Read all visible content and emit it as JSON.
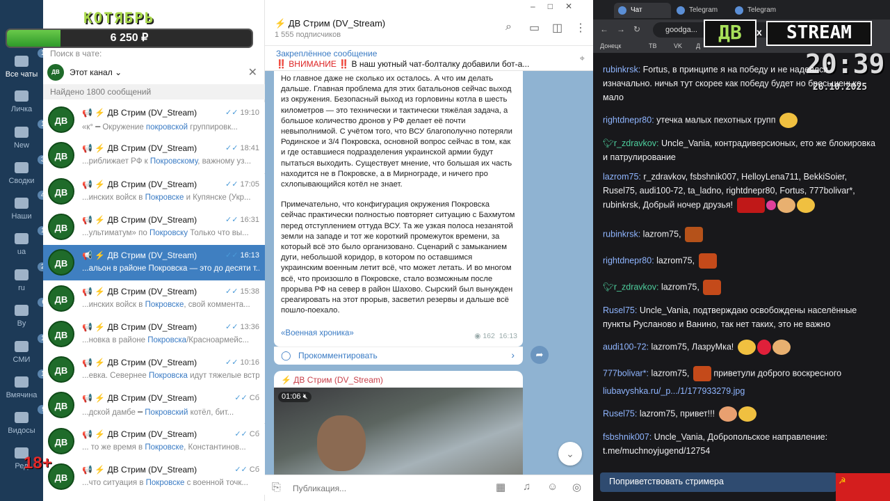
{
  "overlay": {
    "brand": "КОТЯБРЬ",
    "amount": "6 250 ₽",
    "progress_fraction": 0.22,
    "age": "18+"
  },
  "folders": [
    {
      "label": "Все чаты",
      "badge": "174"
    },
    {
      "label": "Личка",
      "badge": ""
    },
    {
      "label": "New",
      "badge": "155"
    },
    {
      "label": "Сводки",
      "badge": "33"
    },
    {
      "label": "Наши",
      "badge": "45"
    },
    {
      "label": "ua",
      "badge": "12"
    },
    {
      "label": "ru",
      "badge": "27"
    },
    {
      "label": "By",
      "badge": "6"
    },
    {
      "label": "СМИ",
      "badge": "12"
    },
    {
      "label": "Вмячина",
      "badge": "18"
    },
    {
      "label": "Видосы",
      "badge": "9"
    },
    {
      "label": "Ред",
      "badge": ""
    }
  ],
  "search": {
    "label": "Поиск в чате:",
    "scope": "Этот канал",
    "found": "Найдено 1800 сообщений",
    "avatar": "ДВ"
  },
  "results": [
    {
      "title": "📢 ⚡ ДВ Стрим (DV_Stream)",
      "time": "19:10",
      "pre": "«к° ━ Окружение ",
      "hl": "покровской",
      "post": " группировк..."
    },
    {
      "title": "📢 ⚡ ДВ Стрим (DV_Stream)",
      "time": "18:41",
      "pre": "...риближает РФ к ",
      "hl": "Покровскому",
      "post": ", важному уз..."
    },
    {
      "title": "📢 ⚡ ДВ Стрим (DV_Stream)",
      "time": "17:05",
      "pre": "...инских войск в ",
      "hl": "Покровске",
      "post": " и Купянске (Укр..."
    },
    {
      "title": "📢 ⚡ ДВ Стрим (DV_Stream)",
      "time": "16:31",
      "pre": "...ультиматум» по ",
      "hl": "Покровску",
      "post": " Только что вы..."
    },
    {
      "title": "📢 ⚡ ДВ Стрим (DV_Stream)",
      "time": "16:13",
      "pre": "...альон в районе Покровска — это до десяти т...",
      "hl": "",
      "post": ""
    },
    {
      "title": "📢 ⚡ ДВ Стрим (DV_Stream)",
      "time": "15:38",
      "pre": "...инских войск в ",
      "hl": "Покровске",
      "post": ", свой коммента..."
    },
    {
      "title": "📢 ⚡ ДВ Стрим (DV_Stream)",
      "time": "13:36",
      "pre": "...новка в районе ",
      "hl": "Покровска",
      "post": "/Красноармейс..."
    },
    {
      "title": "📢 ⚡ ДВ Стрим (DV_Stream)",
      "time": "10:16",
      "pre": "...евка. Севернее ",
      "hl": "Покровска",
      "post": " идут тяжелые встр..."
    },
    {
      "title": "📢 ⚡ ДВ Стрим (DV_Stream)",
      "time": "Сб",
      "pre": "...дской дамбе ━ ",
      "hl": "Покровский",
      "post": " котёл, бит..."
    },
    {
      "title": "📢 ⚡ ДВ Стрим (DV_Stream)",
      "time": "Сб",
      "pre": "... то же время в ",
      "hl": "Покровске",
      "post": ", Константинов..."
    },
    {
      "title": "📢 ⚡ ДВ Стрим (DV_Stream)",
      "time": "Сб",
      "pre": "...что ситуация в ",
      "hl": "Покровске",
      "post": " с военной точк..."
    }
  ],
  "header": {
    "title": "⚡ ДВ Стрим (DV_Stream)",
    "subs": "1 555 подписчиков"
  },
  "pinned": {
    "title": "Закреплённое сообщение",
    "warn": "‼️ ВНИМАНИЕ ‼️",
    "text": " В наш уютный чат-болталку добавили бот-а..."
  },
  "msg1": {
    "p1": "Но главное даже не сколько их осталось. А что им делать дальше. Главная проблема для этих батальонов сейчас выход из окружения. Безопасный выход из горловины котла в шесть километров — это технически и тактически тяжёлая задача, а большое количество дронов у РФ делает её почти невыполнимой.  С учётом того, что ВСУ благополучно потеряли Родинское и 3/4 Покровска, основной вопрос сейчас в том, как и где оставшиеся подразделения украинской армии будут пытаться выходить. Существует мнение, что большая их часть находится не в Покровске, а в Мирнограде, и ничего про схлопывающийся котёл не знает.",
    "p2": "Примечательно, что конфигурация окружения Покровска сейчас практически полностью повторяет ситуацию с Бахмутом перед отступлением оттуда ВСУ. Та же узкая полоса незанятой земли на западе и тот же короткий промежуток времени, за который всё это было организовано. Сценарий с замыканием дуги, небольшой коридор, в котором по оставшимся украинским военным летит всё, что может летать. И во многом всё, что произошло в Покровске, стало возможным после прорыва РФ на север в район Шахово. Сырский был вынужден среагировать на этот прорыв, засветил резервы и дальше всё пошло-поехало.",
    "tag": "«Военная хроника»",
    "views": "162",
    "time": "16:13"
  },
  "comment": {
    "label": "Прокомментировать"
  },
  "msg2": {
    "author": "⚡ ДВ Стрим (DV_Stream)",
    "duration": "01:06"
  },
  "composer": {
    "placeholder": "Публикация..."
  },
  "browser": {
    "tabs": [
      "Чат",
      "Telegram",
      "Telegram"
    ],
    "url": "goodga...",
    "bookmarks": [
      "Донецк",
      "ТВ",
      "VK",
      "Д"
    ]
  },
  "stream_logo": {
    "dv": "ДВ",
    "x": "x",
    "stream": "STREAM"
  },
  "clock": {
    "time": "20:39",
    "date": "26.10.2025"
  },
  "twitch": [
    {
      "user": "rubinkrsk:",
      "color": "#8fb5ff",
      "text": " Fortus, в принципе я на победу и не надеялся изначально. ничья тут скорее как победу будет но бросьшенько мало"
    },
    {
      "user": "rightdnepr80:",
      "color": "#8fb5ff",
      "text": " утечка малых пехотных групп"
    },
    {
      "user": "r_zdravkov:",
      "color": "#4ecf9e",
      "text": " Uncle_Vania, контрадиверсионых, ето же блокировка и патрулирование"
    },
    {
      "user": "lazrom75:",
      "color": "#8fb5ff",
      "text": " r_zdravkov, fsbshnik007, HelloyLena711, BekkiSoier, Rusel75, audi100-72, ta_ladno, rightdnepr80, Fortus, 777bolivar*, rubinkrsk, Добрый ночер друзья!"
    },
    {
      "user": "rubinkrsk:",
      "color": "#8fb5ff",
      "text": " lazrom75,"
    },
    {
      "user": "rightdnepr80:",
      "color": "#8fb5ff",
      "text": " lazrom75,"
    },
    {
      "user": "r_zdravkov:",
      "color": "#4ecf9e",
      "text": " lazrom75,"
    },
    {
      "user": "Rusel75:",
      "color": "#8fb5ff",
      "text": " Uncle_Vania, подтверждаю освобождены населённые пункты Русланово и Ванино, так нет таких, это не важно"
    },
    {
      "user": "audi100-72:",
      "color": "#8fb5ff",
      "text": " lazrom75, ЛазруМка!"
    },
    {
      "user": "777bolivar*:",
      "color": "#8fb5ff",
      "text": " lazrom75,"
    },
    {
      "user": "",
      "color": "#8fb5ff",
      "text": "liubavyshka.ru/_p.../1/177933279.jpg"
    },
    {
      "user": "Rusel75:",
      "color": "#8fb5ff",
      "text": " lazrom75, привет!!!"
    },
    {
      "user": "fsbshnik007:",
      "color": "#8fb5ff",
      "text": " Uncle_Vania, Добропольское направление: t.me/muchnoyjugend/12754"
    }
  ],
  "twitch_extra": {
    "bolivar_tail": " приветули доброго воскресного"
  },
  "greet": {
    "label": "Поприветствовать стримера"
  }
}
